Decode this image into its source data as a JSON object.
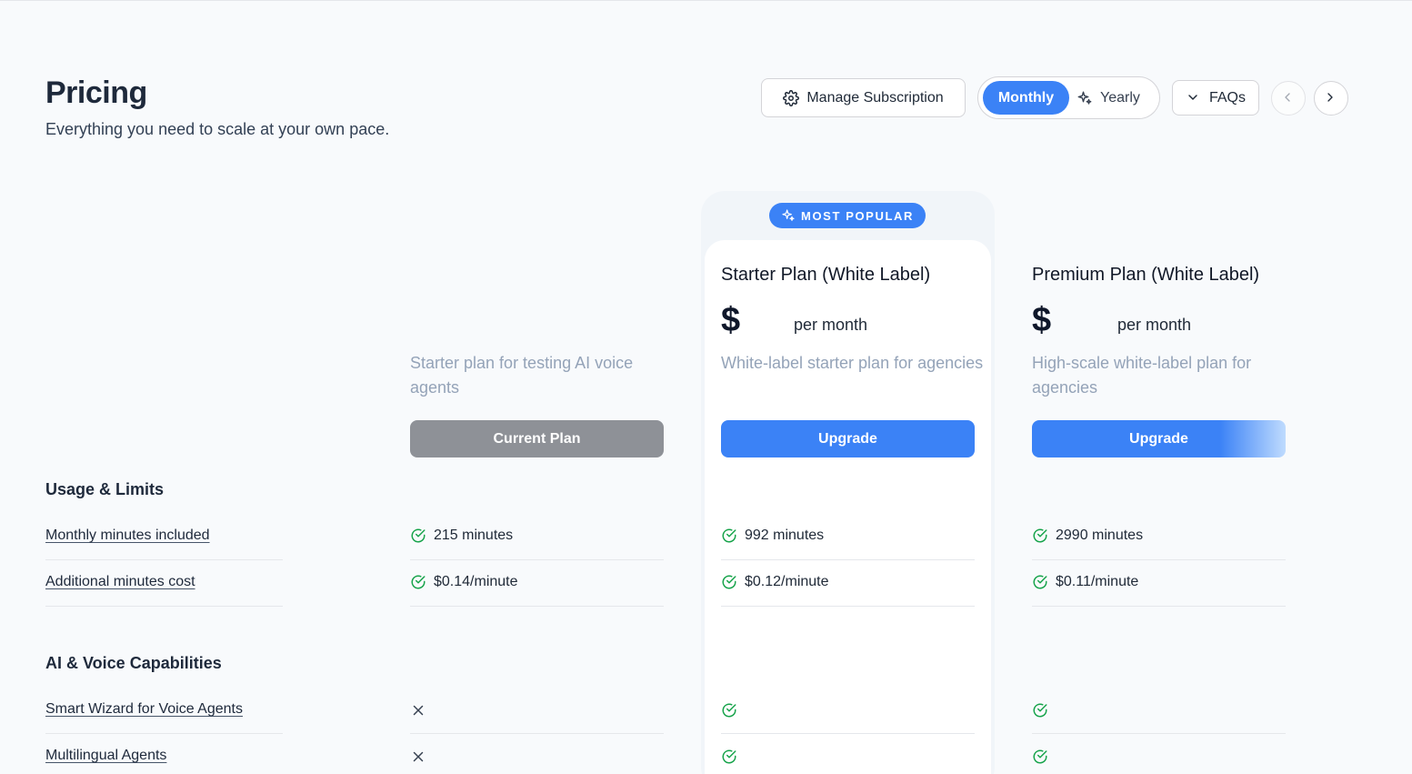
{
  "header": {
    "title": "Pricing",
    "subtitle": "Everything you need to scale at your own pace.",
    "manage_subscription": "Manage Subscription",
    "billing_toggle": {
      "monthly": "Monthly",
      "yearly": "Yearly",
      "selected": "Monthly"
    },
    "faqs": "FAQs"
  },
  "badge": "MOST POPULAR",
  "plans": [
    {
      "name": "",
      "price": "",
      "period": "",
      "description": "Starter plan for testing AI voice agents",
      "button": "Current Plan"
    },
    {
      "name": "Starter Plan (White Label)",
      "price": "$",
      "period": "per month",
      "description": "White-label starter plan for agencies",
      "button": "Upgrade"
    },
    {
      "name": "Premium Plan (White Label)",
      "price": "$",
      "period": "per month",
      "description": "High-scale white-label plan for agencies",
      "button": "Upgrade"
    }
  ],
  "sections": [
    {
      "title": "Usage & Limits",
      "rows": [
        {
          "label": "Monthly minutes included",
          "values": [
            "215 minutes",
            "992 minutes",
            "2990 minutes"
          ],
          "included": [
            true,
            true,
            true
          ]
        },
        {
          "label": "Additional minutes cost",
          "values": [
            "$0.14/minute",
            "$0.12/minute",
            "$0.11/minute"
          ],
          "included": [
            true,
            true,
            true
          ]
        }
      ]
    },
    {
      "title": "AI & Voice Capabilities",
      "rows": [
        {
          "label": "Smart Wizard for Voice Agents",
          "values": [
            "",
            "",
            ""
          ],
          "included": [
            false,
            true,
            true
          ]
        },
        {
          "label": "Multilingual Agents",
          "values": [
            "",
            "",
            ""
          ],
          "included": [
            false,
            true,
            true
          ]
        }
      ]
    }
  ],
  "colors": {
    "accent": "#3b82f6",
    "check": "#16a34a",
    "current_plan_button": "#8e9197",
    "muted_text": "#94a3b8"
  },
  "icons": {
    "manage": "gear-icon",
    "yearly": "sparkle-icon",
    "faqs": "chevron-down-icon",
    "prev": "chevron-left-icon",
    "next": "chevron-right-icon",
    "included": "check-circle-icon",
    "excluded": "x-icon"
  }
}
